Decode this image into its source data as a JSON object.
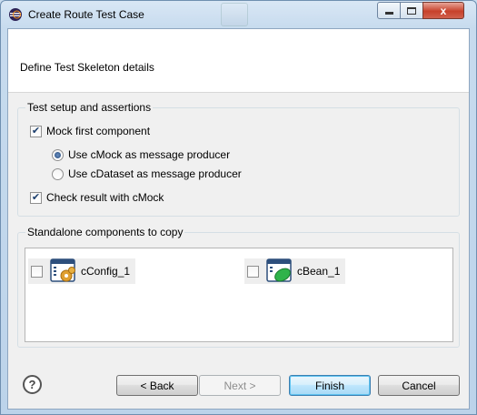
{
  "window": {
    "title": "Create Route Test Case"
  },
  "header": {
    "description": "Define Test Skeleton details"
  },
  "test_setup": {
    "title": "Test setup and assertions",
    "mock_first": {
      "label": "Mock first component",
      "checked": true
    },
    "producer_options": [
      {
        "label": "Use cMock as message producer",
        "selected": true
      },
      {
        "label": "Use cDataset as message producer",
        "selected": false
      }
    ],
    "check_result": {
      "label": "Check result with cMock",
      "checked": true
    }
  },
  "standalone": {
    "title": "Standalone components to copy",
    "items": [
      {
        "label": "cConfig_1",
        "checked": false,
        "icon": "config-component-icon"
      },
      {
        "label": "cBean_1",
        "checked": false,
        "icon": "bean-component-icon"
      }
    ]
  },
  "buttons": {
    "help": "?",
    "back": "< Back",
    "next": "Next >",
    "finish": "Finish",
    "cancel": "Cancel"
  },
  "window_controls": {
    "close": "x"
  }
}
